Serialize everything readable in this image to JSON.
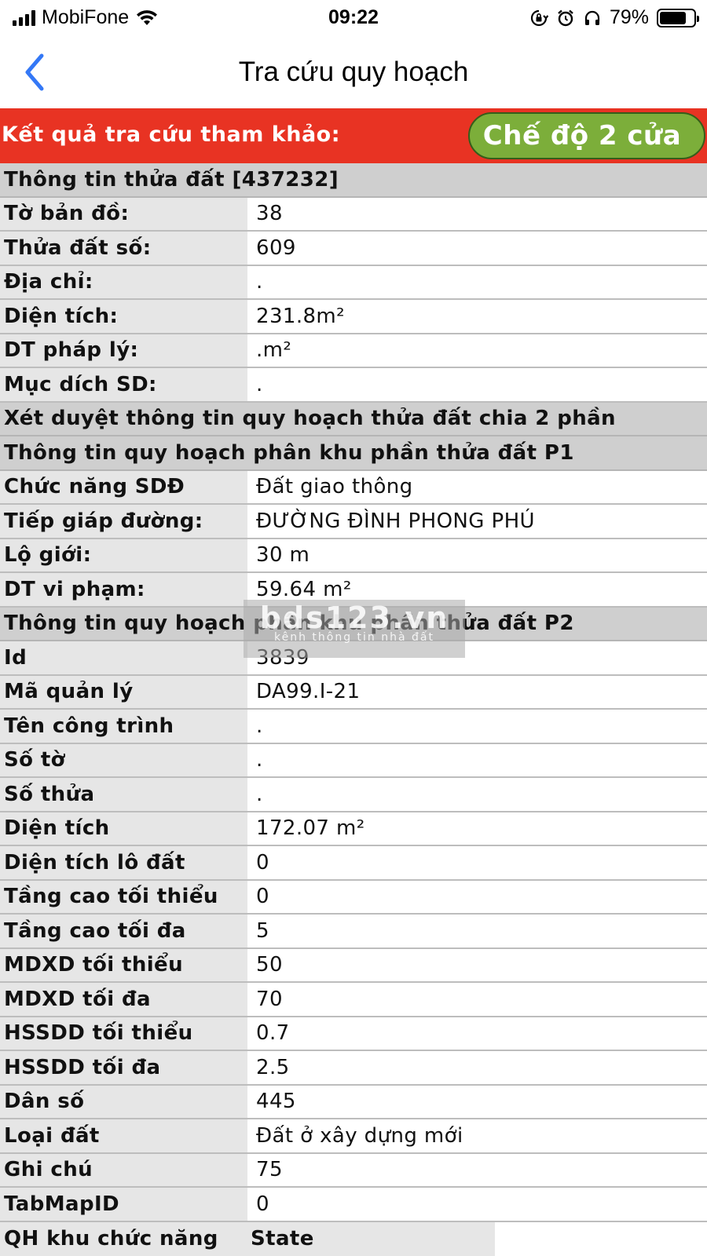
{
  "status_bar": {
    "carrier": "MobiFone",
    "time": "09:22",
    "battery_percent": "79%",
    "battery_level": 0.79
  },
  "nav": {
    "title": "Tra cứu quy hoạch",
    "back_icon": "chevron-left-icon",
    "accent": "#3478f6"
  },
  "banner": {
    "label": "Kết quả tra cứu tham khảo:",
    "mode_button": "Chế độ 2 cửa",
    "color": "#e83323",
    "button_color": "#7cae3a"
  },
  "parcel": {
    "header": "Thông tin thửa đất [437232]",
    "rows": [
      {
        "label": "Tờ bản đồ:",
        "value": "38"
      },
      {
        "label": "Thửa đất số:",
        "value": "609"
      },
      {
        "label": "Địa chỉ:",
        "value": "."
      },
      {
        "label": "Diện tích:",
        "value": "231.8m²"
      },
      {
        "label": "DT pháp lý:",
        "value": ".m²"
      },
      {
        "label": "Mục dích SD:",
        "value": "."
      }
    ]
  },
  "review_header": "Xét duyệt thông tin quy hoạch thửa đất chia 2 phần",
  "p1": {
    "header": "Thông tin quy hoạch phân khu phần thửa đất P1",
    "rows": [
      {
        "label": "Chức năng SDĐ",
        "value": "Đất giao thông"
      },
      {
        "label": "Tiếp giáp đường:",
        "value": "ĐƯỜNG ĐÌNH PHONG PHÚ"
      },
      {
        "label": "Lộ giới:",
        "value": "30 m"
      },
      {
        "label": "DT vi phạm:",
        "value": "59.64 m²"
      }
    ]
  },
  "p2": {
    "header": "Thông tin quy hoạch phân khu phần thửa đất P2",
    "rows": [
      {
        "label": "Id",
        "value": "3839"
      },
      {
        "label": "Mã quản lý",
        "value": "DA99.I-21"
      },
      {
        "label": "Tên công trình",
        "value": "."
      },
      {
        "label": "Số tờ",
        "value": "."
      },
      {
        "label": "Số thửa",
        "value": "."
      },
      {
        "label": "Diện tích",
        "value": "172.07 m²"
      },
      {
        "label": "Diện tích lô đất",
        "value": "0"
      },
      {
        "label": "Tầng cao tối thiểu",
        "value": "0"
      },
      {
        "label": "Tầng cao tối đa",
        "value": "5"
      },
      {
        "label": "MDXD tối thiểu",
        "value": "50"
      },
      {
        "label": "MDXD tối đa",
        "value": "70"
      },
      {
        "label": "HSSDD tối thiểu",
        "value": "0.7"
      },
      {
        "label": "HSSDD tối đa",
        "value": "2.5"
      },
      {
        "label": "Dân số",
        "value": "445"
      },
      {
        "label": "Loại đất",
        "value": "Đất ở xây dựng mới"
      },
      {
        "label": "Ghi chú",
        "value": "75"
      },
      {
        "label": "TabMapID",
        "value": "0"
      }
    ]
  },
  "last_row": {
    "label": "QH khu chức năng",
    "value": "State"
  },
  "watermark": {
    "main": "bds123.vn",
    "sub": "kênh thông tin nhà đất"
  }
}
